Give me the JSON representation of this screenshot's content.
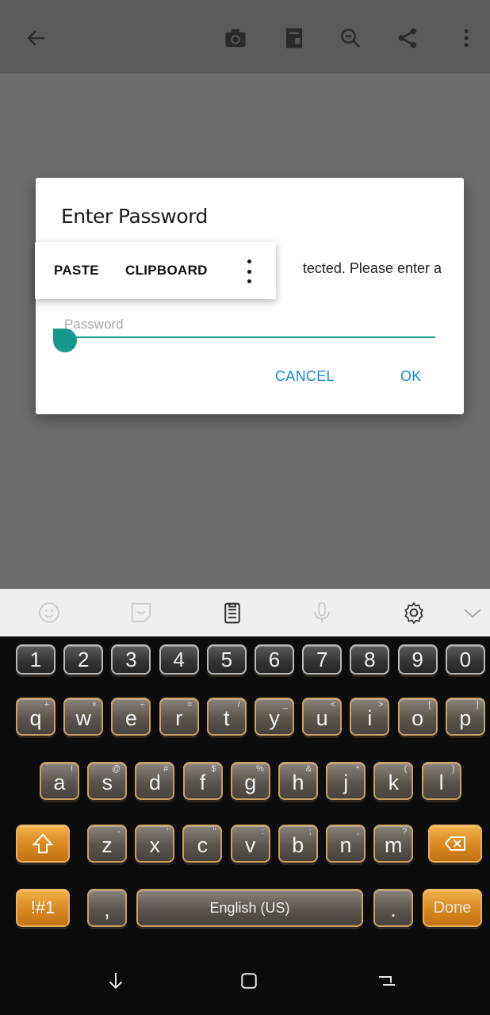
{
  "toolbar": {
    "icons": [
      "back-arrow-icon",
      "camera-icon",
      "document-export-icon",
      "zoom-out-icon",
      "share-icon",
      "more-vert-icon"
    ]
  },
  "dialog": {
    "title": "Enter Password",
    "message_visible": "tected. Please enter a",
    "password_placeholder": "Password",
    "password_value": "",
    "cancel_label": "CANCEL",
    "ok_label": "OK",
    "accent": "#16998c",
    "button_color": "#1a8bd2"
  },
  "context_menu": {
    "paste_label": "PASTE",
    "clipboard_label": "CLIPBOARD"
  },
  "keyboard": {
    "toolbar_icons": [
      "emoji-icon",
      "sticker-icon",
      "clipboard-icon",
      "mic-icon",
      "settings-icon",
      "collapse-icon"
    ],
    "number_row": [
      "1",
      "2",
      "3",
      "4",
      "5",
      "6",
      "7",
      "8",
      "9",
      "0"
    ],
    "row1": [
      {
        "k": "q",
        "s": "+"
      },
      {
        "k": "w",
        "s": "×"
      },
      {
        "k": "e",
        "s": "÷"
      },
      {
        "k": "r",
        "s": "="
      },
      {
        "k": "t",
        "s": "/"
      },
      {
        "k": "y",
        "s": "_"
      },
      {
        "k": "u",
        "s": "<"
      },
      {
        "k": "i",
        "s": ">"
      },
      {
        "k": "o",
        "s": "["
      },
      {
        "k": "p",
        "s": "]"
      }
    ],
    "row2": [
      {
        "k": "a",
        "s": "!"
      },
      {
        "k": "s",
        "s": "@"
      },
      {
        "k": "d",
        "s": "#"
      },
      {
        "k": "f",
        "s": "$"
      },
      {
        "k": "g",
        "s": "%"
      },
      {
        "k": "h",
        "s": "&"
      },
      {
        "k": "j",
        "s": "*"
      },
      {
        "k": "k",
        "s": "("
      },
      {
        "k": "l",
        "s": ")"
      }
    ],
    "row3": [
      {
        "k": "z",
        "s": "-"
      },
      {
        "k": "x",
        "s": "'"
      },
      {
        "k": "c",
        "s": "\""
      },
      {
        "k": "v",
        "s": ":"
      },
      {
        "k": "b",
        "s": ";"
      },
      {
        "k": "n",
        "s": ","
      },
      {
        "k": "m",
        "s": "?"
      }
    ],
    "symbols_label": "!#1",
    "comma_label": ",",
    "space_label": "English (US)",
    "period_label": ".",
    "done_label": "Done",
    "accent_orange": "#d8861f",
    "gold_border": "#c8a060"
  },
  "navbar": {
    "icons": [
      "recents-down-icon",
      "home-square-icon",
      "back-nav-icon"
    ]
  }
}
